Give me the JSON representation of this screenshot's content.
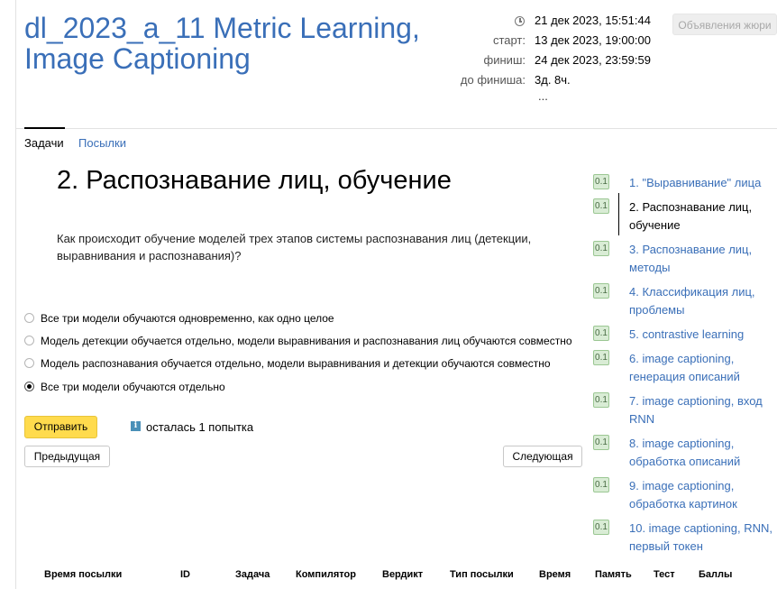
{
  "contest": {
    "title": "dl_2023_a_11 Metric Learning, Image Captioning",
    "current_time": "21 дек 2023, 15:51:44",
    "start_label": "старт:",
    "start": "13 дек 2023, 19:00:00",
    "finish_label": "финиш:",
    "finish": "24 дек 2023, 23:59:59",
    "remaining_label": "до финиша:",
    "remaining": "3д. 8ч.",
    "more": "...",
    "jury_button": "Объявления жюри"
  },
  "tabs": [
    {
      "label": "Задачи",
      "active": true
    },
    {
      "label": "Посылки",
      "active": false
    }
  ],
  "problem": {
    "title": "2. Распознавание лиц, обучение",
    "question": "Как происходит обучение моделей трех этапов системы распознавания лиц (детекции, выравнивания и распознавания)?",
    "options": [
      {
        "label": "Все три модели обучаются одновременно, как одно целое",
        "checked": false
      },
      {
        "label": "Модель детекции обучается отдельно, модели выравнивания и распознавания лиц обучаются совместно",
        "checked": false
      },
      {
        "label": "Модель распознавания обучается отдельно, модели выравнивания и детекции обучаются совместно",
        "checked": false
      },
      {
        "label": "Все три модели обучаются отдельно",
        "checked": true
      }
    ],
    "submit_label": "Отправить",
    "attempts_text": "осталась 1 попытка",
    "info_icon": "i",
    "prev_label": "Предыдущая",
    "next_label": "Следующая"
  },
  "problem_list": [
    {
      "score": "0.1",
      "label": "1. \"Выравнивание\" лица",
      "active": false
    },
    {
      "score": "0.1",
      "label": "2. Распознавание лиц, обучение",
      "active": true
    },
    {
      "score": "0.1",
      "label": "3. Распознавание лиц, методы",
      "active": false
    },
    {
      "score": "0.1",
      "label": "4. Классификация лиц, проблемы",
      "active": false
    },
    {
      "score": "0.1",
      "label": "5. contrastive learning",
      "active": false
    },
    {
      "score": "0.1",
      "label": "6. image captioning, генерация описаний",
      "active": false
    },
    {
      "score": "0.1",
      "label": "7. image captioning, вход RNN",
      "active": false
    },
    {
      "score": "0.1",
      "label": "8. image captioning, обработка описаний",
      "active": false
    },
    {
      "score": "0.1",
      "label": "9. image captioning, обработка картинок",
      "active": false
    },
    {
      "score": "0.1",
      "label": "10. image captioning, RNN, первый токен",
      "active": false
    }
  ],
  "submissions_table": {
    "columns": [
      "Время посылки",
      "ID",
      "Задача",
      "Компилятор",
      "Вердикт",
      "Тип посылки",
      "Время",
      "Память",
      "Тест",
      "Баллы"
    ]
  },
  "colors": {
    "link": "#3a6fb8",
    "submit": "#ffdb4d",
    "badge_bg": "#d9ecd5",
    "badge_border": "#9bc793"
  }
}
